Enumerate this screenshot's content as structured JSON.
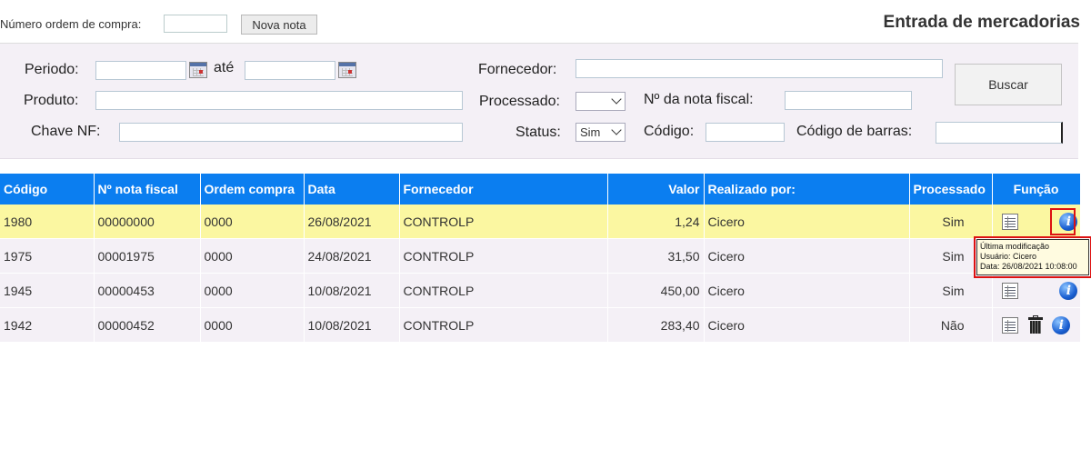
{
  "header": {
    "order_label": "Número ordem de compra:",
    "order_value": "",
    "new_note_button": "Nova nota",
    "page_title": "Entrada de mercadorias"
  },
  "filters": {
    "periodo_label": "Periodo:",
    "ate_label": "até",
    "fornecedor_label": "Fornecedor:",
    "produto_label": "Produto:",
    "processado_label": "Processado:",
    "processado_value": "",
    "nota_fiscal_label": "Nº da nota fiscal:",
    "chave_label": "Chave NF:",
    "status_label": "Status:",
    "status_value": "Sim",
    "codigo_label": "Código:",
    "barras_label": "Código de barras:",
    "buscar_button": "Buscar"
  },
  "table": {
    "columns": [
      "Código",
      "Nº nota fiscal",
      "Ordem compra",
      "Data",
      "Fornecedor",
      "Valor",
      "Realizado por:",
      "Processado",
      "Função"
    ],
    "rows": [
      {
        "codigo": "1980",
        "nota": "00000000",
        "ordem": "0000",
        "data": "26/08/2021",
        "fornecedor": "CONTROLP",
        "valor": "1,24",
        "realizado": "Cicero",
        "processado": "Sim"
      },
      {
        "codigo": "1975",
        "nota": "00001975",
        "ordem": "0000",
        "data": "24/08/2021",
        "fornecedor": "CONTROLP",
        "valor": "31,50",
        "realizado": "Cicero",
        "processado": "Sim"
      },
      {
        "codigo": "1945",
        "nota": "00000453",
        "ordem": "0000",
        "data": "10/08/2021",
        "fornecedor": "CONTROLP",
        "valor": "450,00",
        "realizado": "Cicero",
        "processado": "Sim"
      },
      {
        "codigo": "1942",
        "nota": "00000452",
        "ordem": "0000",
        "data": "10/08/2021",
        "fornecedor": "CONTROLP",
        "valor": "283,40",
        "realizado": "Cicero",
        "processado": "Não"
      }
    ]
  },
  "tooltip": {
    "line1": "Última modificação",
    "line2": "Usuário: Cicero",
    "line3": "Data: 26/08/2021 10:08:00"
  },
  "icons": {
    "details": "list-icon",
    "info": "info-icon",
    "delete": "trash-icon"
  },
  "colors": {
    "header_bg": "#0b7ef0",
    "highlight_row": "#fbf7a1",
    "panel_bg": "#f4f0f6",
    "highlight_border": "#dd1111"
  }
}
